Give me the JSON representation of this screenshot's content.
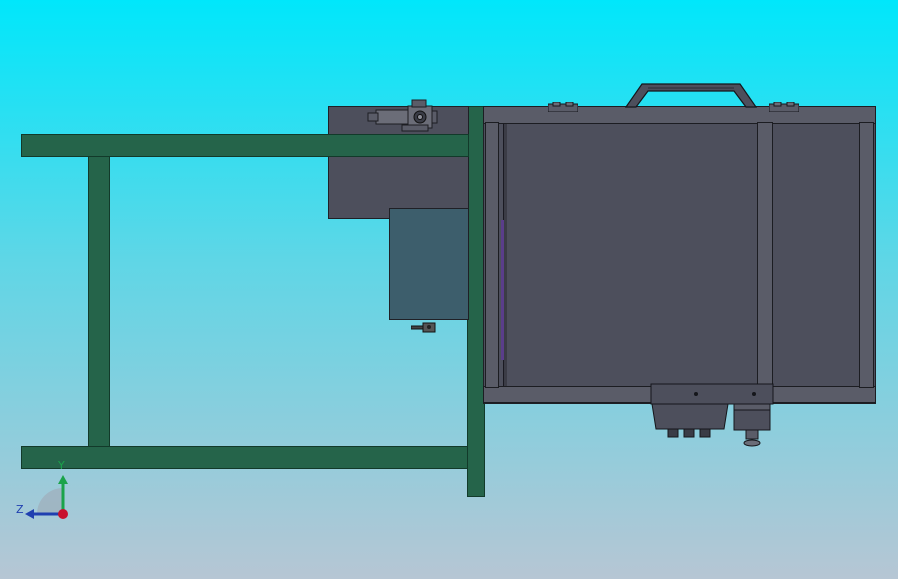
{
  "viewport": {
    "background_top": "#00e7fb",
    "background_bottom": "#b6c6d4",
    "model_colors": {
      "frame": "#25644a",
      "enclosure": "#4d4f5c",
      "panel": "#3d5e6c"
    }
  },
  "triad": {
    "y_label": "Y",
    "z_label": "Z",
    "icon": "coordinate-triad-icon",
    "x_color": "#c8102e",
    "y_color": "#1aa34a",
    "z_color": "#1f3fb0"
  }
}
